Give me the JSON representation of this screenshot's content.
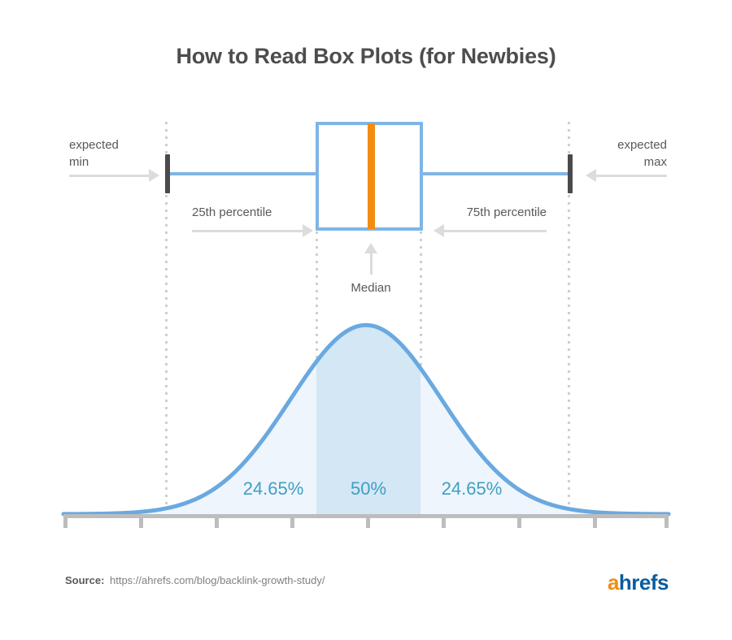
{
  "title": "How to Read Box Plots (for Newbies)",
  "boxplot": {
    "expected_min_label": "expected\nmin",
    "expected_max_label": "expected\nmax",
    "q1_label": "25th percentile",
    "q3_label": "75th percentile",
    "median_label": "Median",
    "colors": {
      "box_stroke": "#7fb5e6",
      "median": "#f28c12",
      "whisker_cap": "#4a4a4a",
      "annotation_arrow": "#dcdcdc",
      "guide_dotted": "#cfcfcf"
    }
  },
  "percentages": {
    "left": "24.65%",
    "center": "50%",
    "right": "24.65%",
    "color": "#3f9fc4"
  },
  "footer": {
    "source_label": "Source:",
    "source_url": "https://ahrefs.com/blog/backlink-growth-study/",
    "logo_first": "a",
    "logo_rest": "hrefs"
  },
  "chart_data": {
    "type": "area",
    "title": "How to Read Box Plots (for Newbies)",
    "xlabel": "",
    "ylabel": "",
    "grid": false,
    "legend": null,
    "description": "Normal distribution curve aligned under a horizontal box-and-whisker plot; dotted guides mark expected min, 25th percentile, median, 75th percentile and expected max.",
    "boxplot_stats": {
      "expected_min": -2.75,
      "q1": -0.675,
      "median": 0,
      "q3": 0.675,
      "expected_max": 2.75
    },
    "axis_ticks": [
      -4,
      -3,
      -2,
      -1,
      0,
      1,
      2,
      3,
      4
    ],
    "region_shares": [
      {
        "name": "expected min to 25th percentile",
        "value": 24.65,
        "unit": "%"
      },
      {
        "name": "25th to 75th percentile (interquartile range)",
        "value": 50,
        "unit": "%"
      },
      {
        "name": "75th percentile to expected max",
        "value": 24.65,
        "unit": "%"
      }
    ],
    "series": [
      {
        "name": "normal density",
        "x": [
          -4.0,
          -3.6,
          -3.2,
          -2.8,
          -2.4,
          -2.0,
          -1.6,
          -1.2,
          -0.8,
          -0.4,
          0.0,
          0.4,
          0.8,
          1.2,
          1.6,
          2.0,
          2.4,
          2.8,
          3.2,
          3.6,
          4.0
        ],
        "y": [
          0.0001,
          0.0006,
          0.0024,
          0.0079,
          0.0224,
          0.054,
          0.1109,
          0.1942,
          0.2897,
          0.3683,
          0.3989,
          0.3683,
          0.2897,
          0.1942,
          0.1109,
          0.054,
          0.0224,
          0.0079,
          0.0024,
          0.0006,
          0.0001
        ]
      }
    ],
    "xlim": [
      -4,
      4
    ],
    "ylim": [
      0,
      0.42
    ]
  }
}
